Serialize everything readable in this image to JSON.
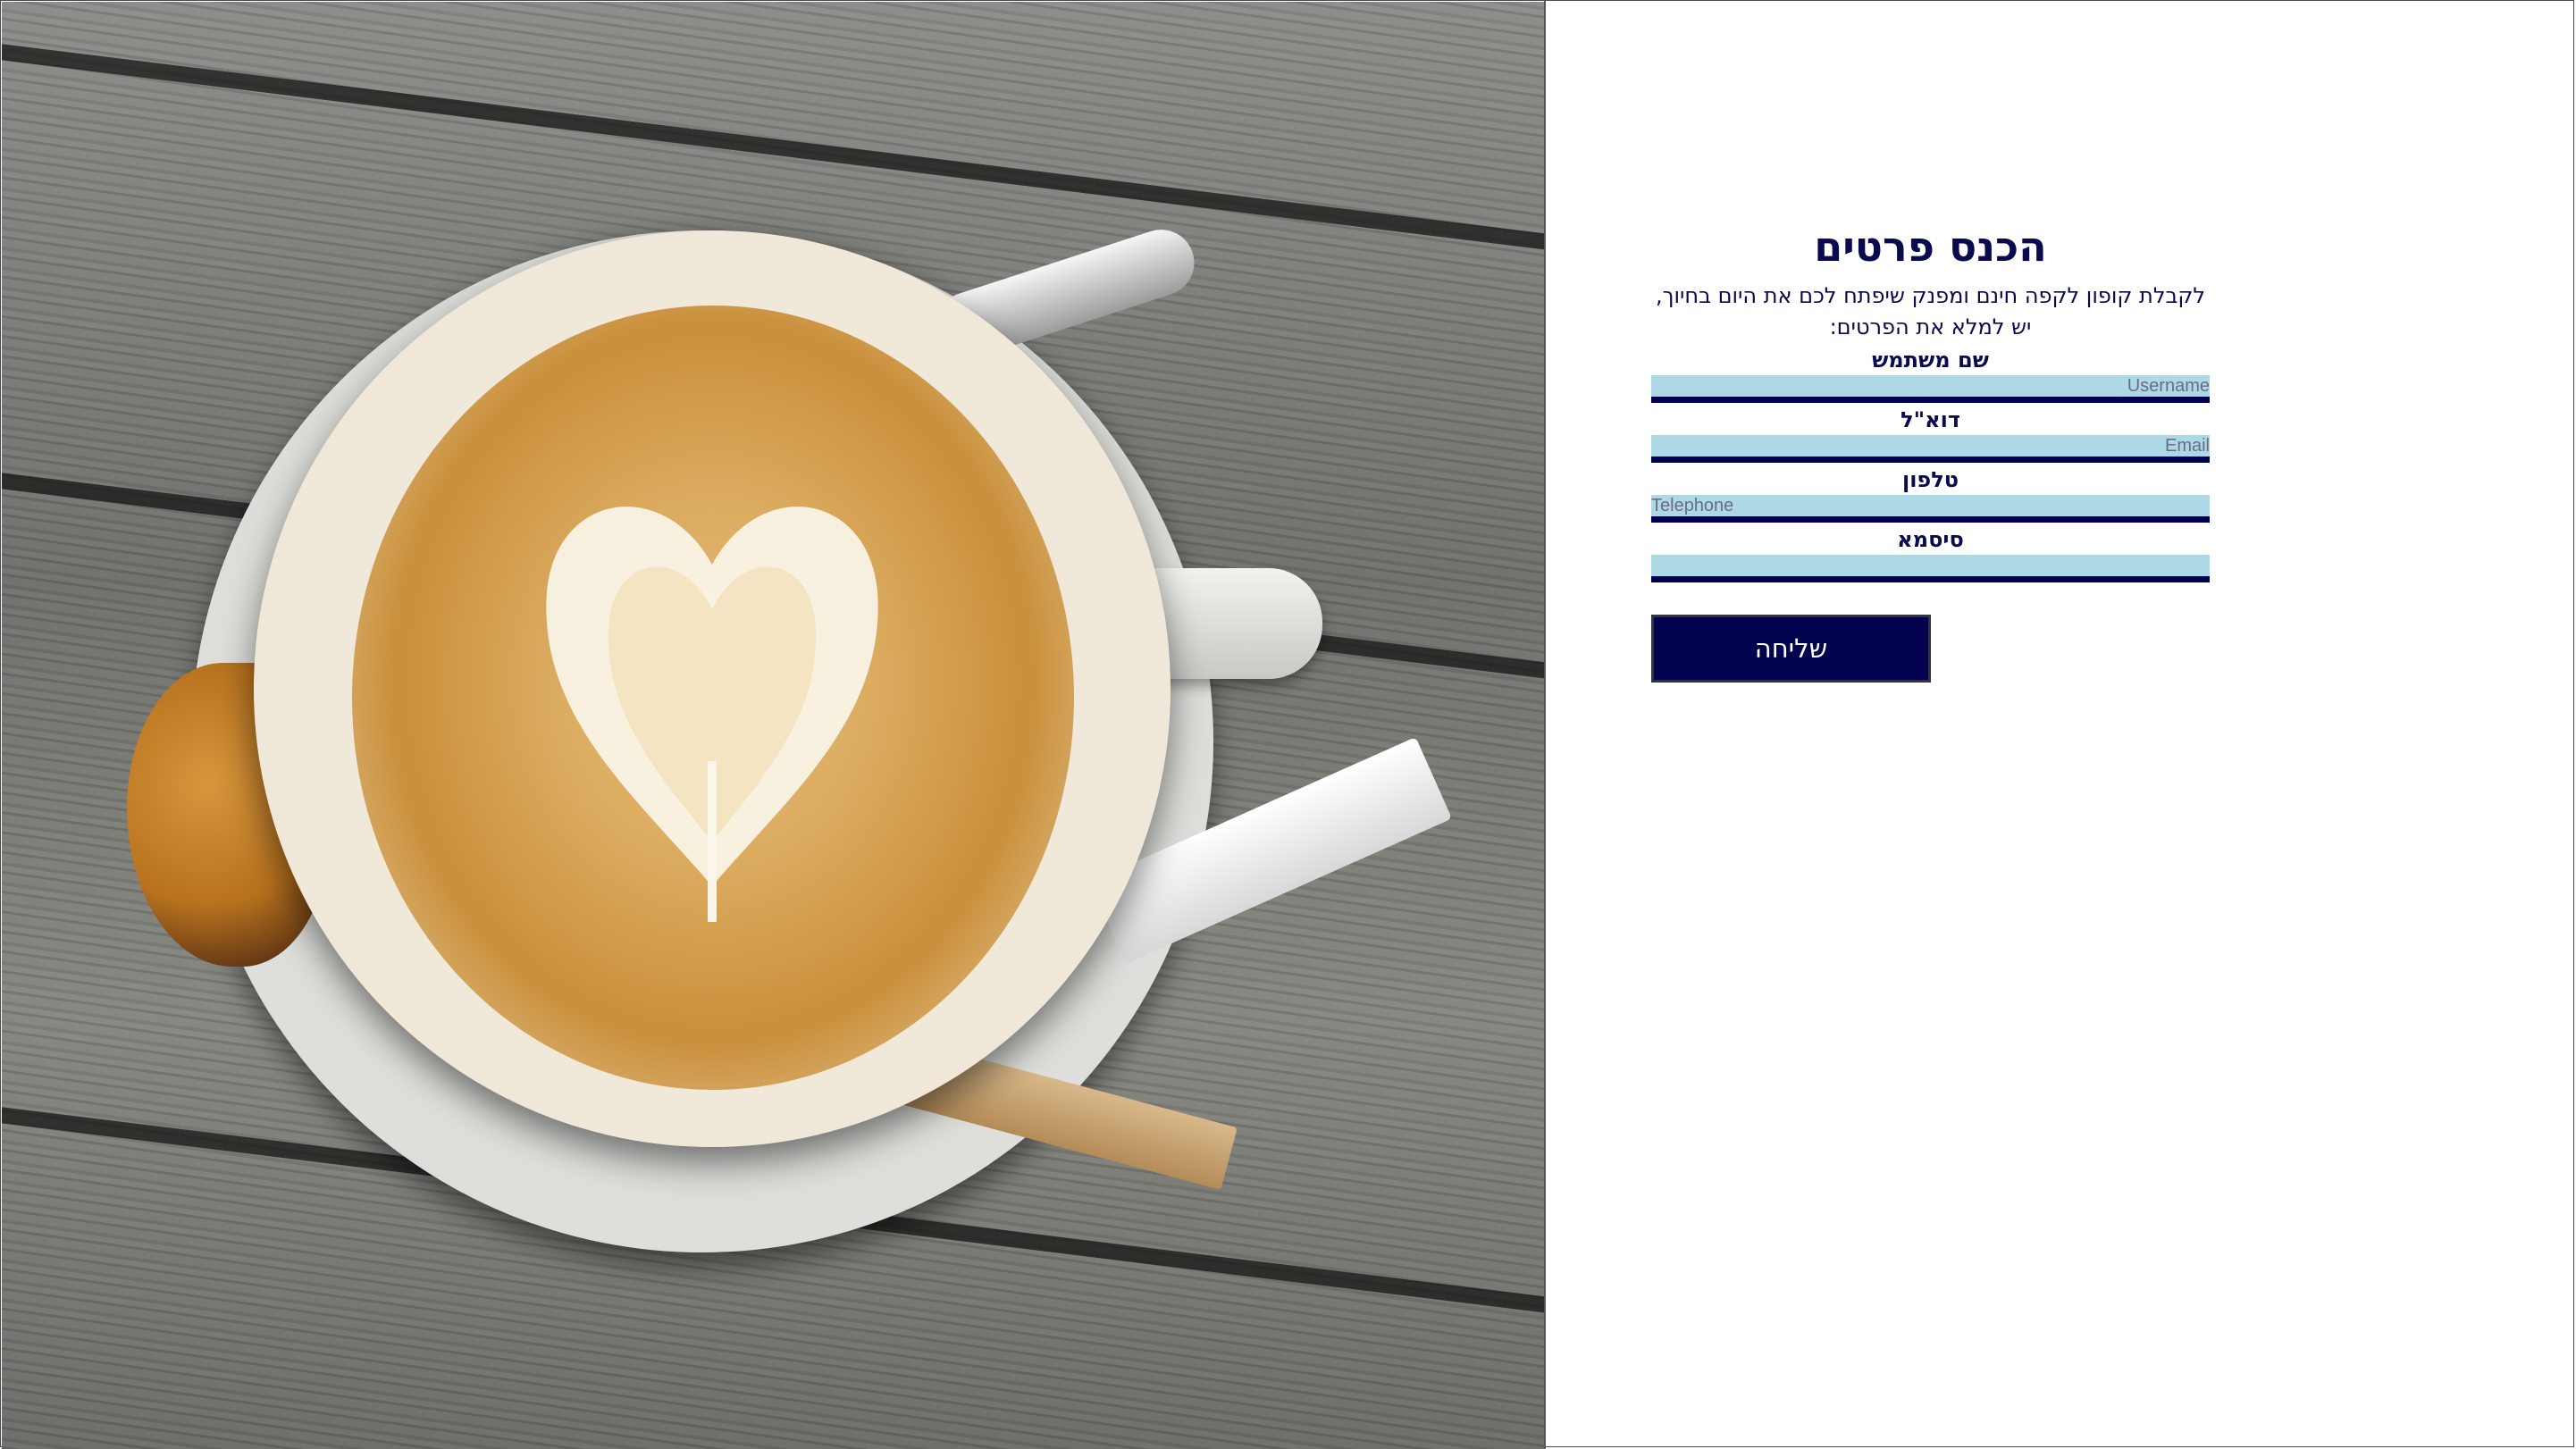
{
  "form": {
    "title": "הכנס פרטים",
    "description": "לקבלת קופון לקפה חינם ומפנק שיפתח לכם את היום בחיוך, יש למלא את הפרטים:",
    "fields": [
      {
        "label": "שם משתמש",
        "placeholder": "Username",
        "value": ""
      },
      {
        "label": "דוא\"ל",
        "placeholder": "Email",
        "value": ""
      },
      {
        "label": "טלפון",
        "placeholder": "Telephone",
        "value": ""
      },
      {
        "label": "סיסמא",
        "placeholder": "",
        "value": ""
      }
    ],
    "submit_label": "שליחה"
  },
  "colors": {
    "navy": "#000050",
    "input_background": "#add8e6",
    "button_background": "#02024e"
  },
  "photo": {
    "subject": "latte art coffee cup on wooden table"
  }
}
